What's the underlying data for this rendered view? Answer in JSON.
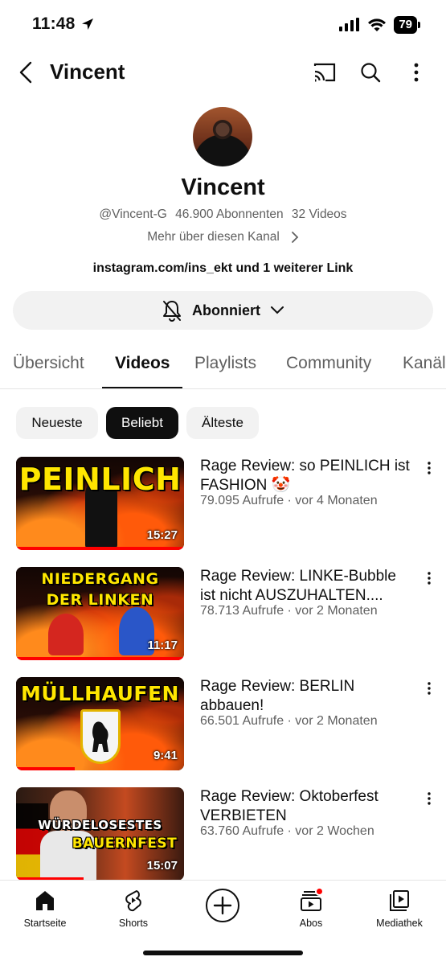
{
  "status": {
    "time": "11:48",
    "battery": "79"
  },
  "header": {
    "title": "Vincent"
  },
  "channel": {
    "name": "Vincent",
    "handle": "@Vincent-G",
    "subscribers": "46.900 Abonnenten",
    "videos": "32 Videos",
    "more_about": "Mehr über diesen Kanal",
    "links": "instagram.com/ins_ekt und 1 weiterer Link",
    "subscribe_label": "Abonniert"
  },
  "tabs": [
    {
      "label": "Übersicht"
    },
    {
      "label": "Videos"
    },
    {
      "label": "Playlists"
    },
    {
      "label": "Community"
    },
    {
      "label": "Kanäle"
    }
  ],
  "chips": [
    {
      "label": "Neueste"
    },
    {
      "label": "Beliebt"
    },
    {
      "label": "Älteste"
    }
  ],
  "videos": [
    {
      "thumb_text": "PEINLICH",
      "duration": "15:27",
      "title": "Rage Review: so PEINLICH ist FASHION 🤡",
      "meta": "79.095 Aufrufe · vor 4 Monaten",
      "progress": 1.0
    },
    {
      "thumb_text_1": "NIEDERGANG",
      "thumb_text_2": "DER LINKEN",
      "duration": "11:17",
      "title": "Rage Review: LINKE-Bubble ist nicht AUSZUHALTEN....",
      "meta": "78.713 Aufrufe · vor 2 Monaten",
      "progress": 1.0
    },
    {
      "thumb_text": "MÜLLHAUFEN",
      "duration": "9:41",
      "title": "Rage Review: BERLIN abbauen!",
      "meta": "66.501 Aufrufe · vor 2 Monaten",
      "progress": 0.35
    },
    {
      "thumb_text_1": "WÜRDELOSESTES",
      "thumb_text_2": "BAUERNFEST",
      "duration": "15:07",
      "title": "Rage Review: Oktoberfest VERBIETEN",
      "meta": "63.760 Aufrufe · vor 2 Wochen",
      "progress": 0.4
    }
  ],
  "nav": [
    {
      "label": "Startseite",
      "icon": "home-icon"
    },
    {
      "label": "Shorts",
      "icon": "shorts-icon"
    },
    {
      "label": "",
      "icon": "create-icon"
    },
    {
      "label": "Abos",
      "icon": "subscriptions-icon"
    },
    {
      "label": "Mediathek",
      "icon": "library-icon"
    }
  ],
  "colors": {
    "accent": "#ff0000",
    "text": "#0f0f0f",
    "secondary": "#606060",
    "chip_bg": "#f2f2f2"
  }
}
